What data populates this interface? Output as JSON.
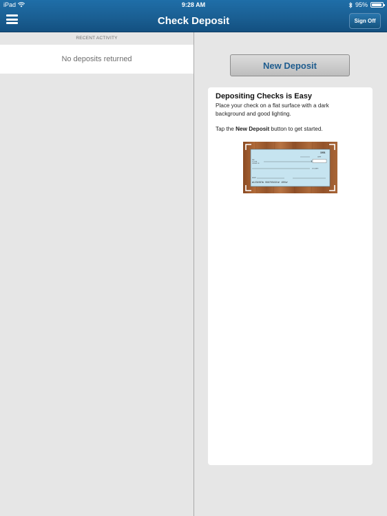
{
  "status_bar": {
    "device": "iPad",
    "time": "9:28 AM",
    "battery": "95%",
    "battery_level": 0.95
  },
  "nav": {
    "title": "Check Deposit",
    "sign_off_label": "Sign Off"
  },
  "recent_activity": {
    "header": "RECENT ACTIVITY",
    "empty_message": "No deposits returned"
  },
  "new_deposit_label": "New Deposit",
  "info": {
    "title": "Depositing Checks is Easy",
    "text": "Place your check on a flat surface with a dark background and good lighting.",
    "tip_prefix": "Tap the ",
    "tip_bold": "New Deposit",
    "tip_suffix": " button to get started."
  },
  "check_image": {
    "check_number": "1001",
    "micr_line": "⑆1234567⑆ 0987654321⑈ 1001⑈"
  },
  "colors": {
    "nav_blue": "#1a5f93",
    "button_text": "#1e5c8e",
    "check_paper": "#bfe0ee",
    "wood": "#9c5a2e"
  }
}
